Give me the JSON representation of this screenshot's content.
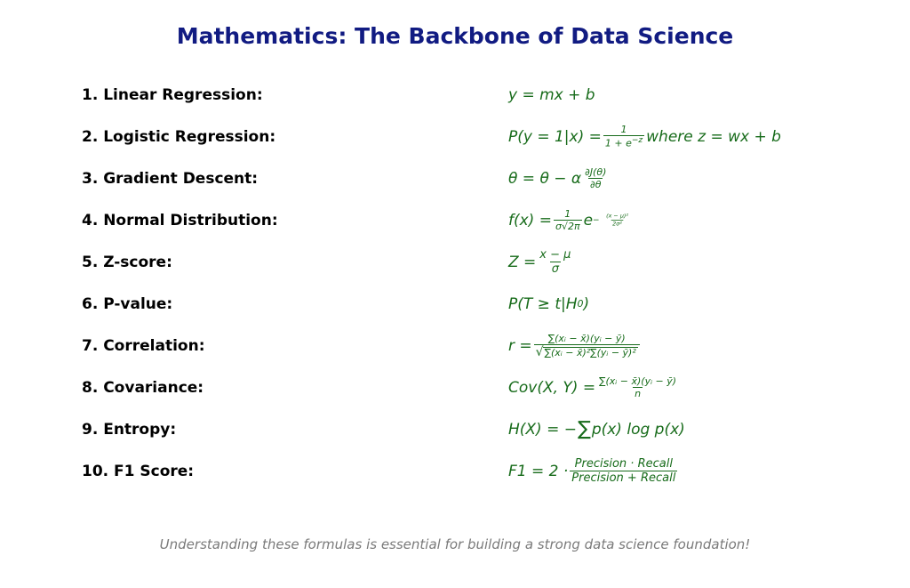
{
  "title": "Mathematics: The Backbone of Data Science",
  "labels": {
    "i1": "1. Linear Regression:",
    "i2": "2. Logistic Regression:",
    "i3": "3. Gradient Descent:",
    "i4": "4. Normal Distribution:",
    "i5": "5. Z-score:",
    "i6": "6. P-value:",
    "i7": "7. Correlation:",
    "i8": "8. Covariance:",
    "i9": "9. Entropy:",
    "i10": "10. F1 Score:"
  },
  "f": {
    "f1": {
      "body": "y = mx + b"
    },
    "f2": {
      "lhs": "P(y = 1|x) =",
      "num": "1",
      "den_a": "1 + e",
      "den_exp": "−z",
      "tail": " where z = wx + b"
    },
    "f3": {
      "lhs": "θ = θ − α",
      "num": "∂J(θ)",
      "den": "∂θ"
    },
    "f4": {
      "lhs": "f(x) =",
      "num1": "1",
      "den1": "σ√2π",
      "mid": "e",
      "exp_lead": "−",
      "exp_num": "(x − μ)²",
      "exp_den": "2σ²"
    },
    "f5": {
      "lhs": "Z =",
      "num": "x − μ",
      "den": "σ"
    },
    "f6": {
      "body_a": "P(T ≥ t|H",
      "sub": "0",
      "body_b": ")"
    },
    "f7": {
      "lhs": "r =",
      "num": "∑(xᵢ − x̄)(yᵢ − ȳ)",
      "den_rad": "∑(xᵢ − x̄)²∑(yᵢ − ȳ)²"
    },
    "f8": {
      "lhs": "Cov(X, Y) =",
      "num": "∑(xᵢ − x̄)(yᵢ − ȳ)",
      "den": "n"
    },
    "f9": {
      "lhs": "H(X) = −",
      "sum": "∑",
      "body": "p(x) log p(x)"
    },
    "f10": {
      "lhs": "F1 = 2 ·",
      "num": "Precision · Recall",
      "den": "Precision + Recall"
    }
  },
  "footer": "Understanding these formulas is essential for building a strong data science foundation!"
}
